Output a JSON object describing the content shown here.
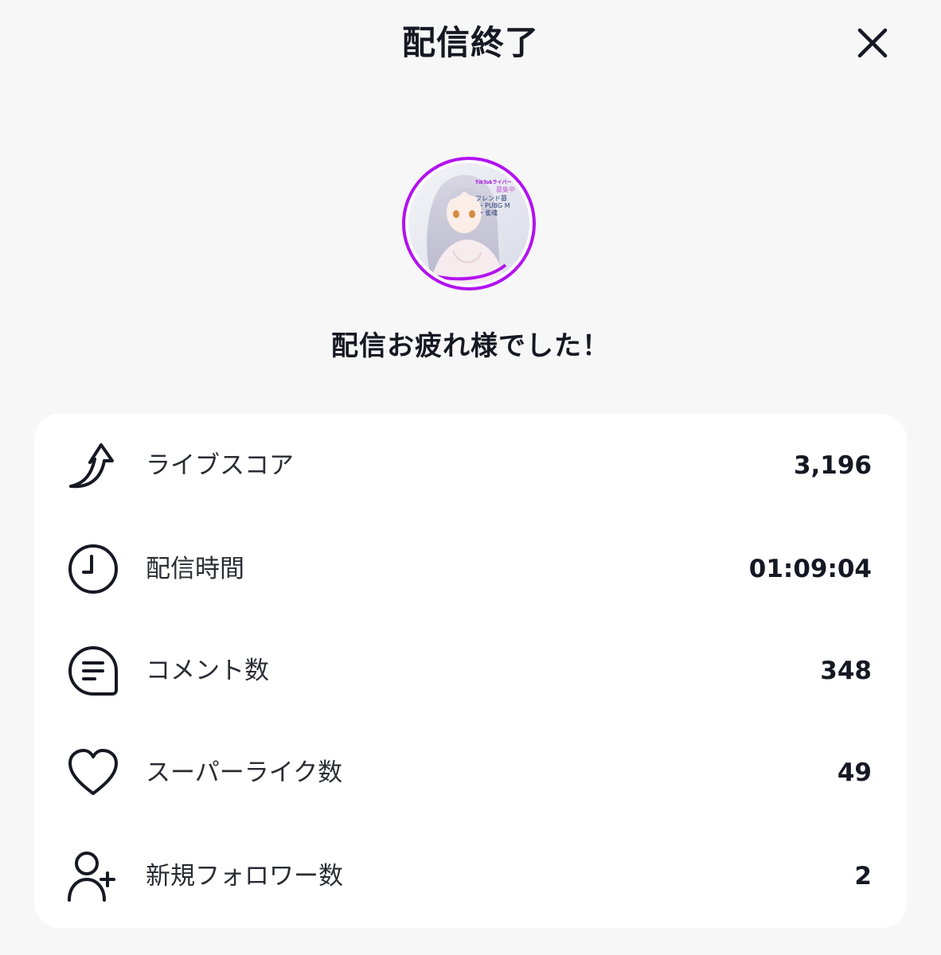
{
  "header": {
    "title": "配信終了"
  },
  "icons": {
    "close": "close-icon"
  },
  "profile": {
    "avatar_ring_color": "#b312f0",
    "avatar_text_lines": [
      "TikTokライバー",
      "募集中",
      "フレンド募",
      "・PUBG M",
      "・雀魂"
    ]
  },
  "message": "配信お疲れ様でした！",
  "stats": [
    {
      "icon": "trending-up-arrow-icon",
      "label": "ライブスコア",
      "value": "3,196"
    },
    {
      "icon": "clock-icon",
      "label": "配信時間",
      "value": "01:09:04"
    },
    {
      "icon": "comment-bubble-icon",
      "label": "コメント数",
      "value": "348"
    },
    {
      "icon": "heart-icon",
      "label": "スーパーライク数",
      "value": "49"
    },
    {
      "icon": "add-user-icon",
      "label": "新規フォロワー数",
      "value": "2"
    }
  ]
}
